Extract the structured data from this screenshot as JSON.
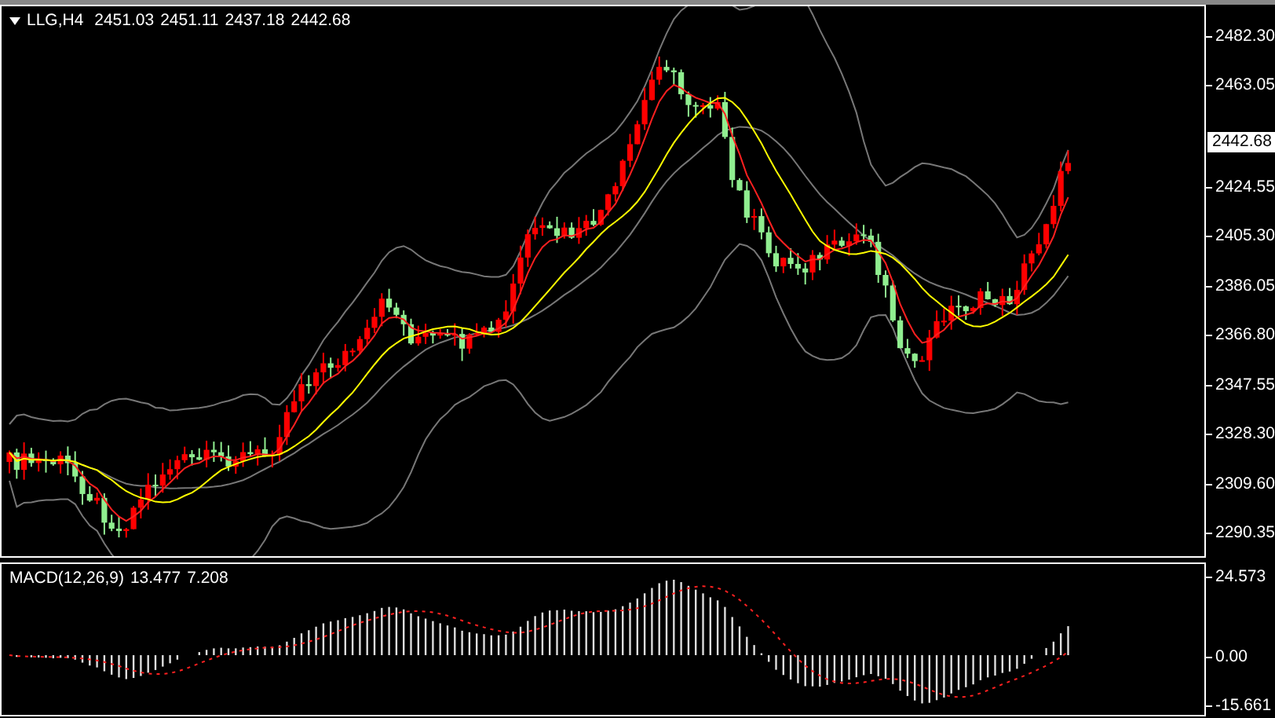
{
  "chart_header": {
    "symbol": "LLG,H4",
    "open": "2451.03",
    "high": "2451.11",
    "low": "2437.18",
    "close": "2442.68"
  },
  "price_axis": {
    "ticks": [
      "2482.30",
      "2463.05",
      "2424.55",
      "2405.30",
      "2386.05",
      "2366.80",
      "2347.55",
      "2328.30",
      "2309.60",
      "2290.35"
    ],
    "current_price": "2442.68"
  },
  "macd": {
    "label": "MACD(12,26,9)",
    "main": "13.477",
    "signal": "7.208",
    "ticks": [
      "24.573",
      "0.00",
      "-15.661"
    ]
  }
}
